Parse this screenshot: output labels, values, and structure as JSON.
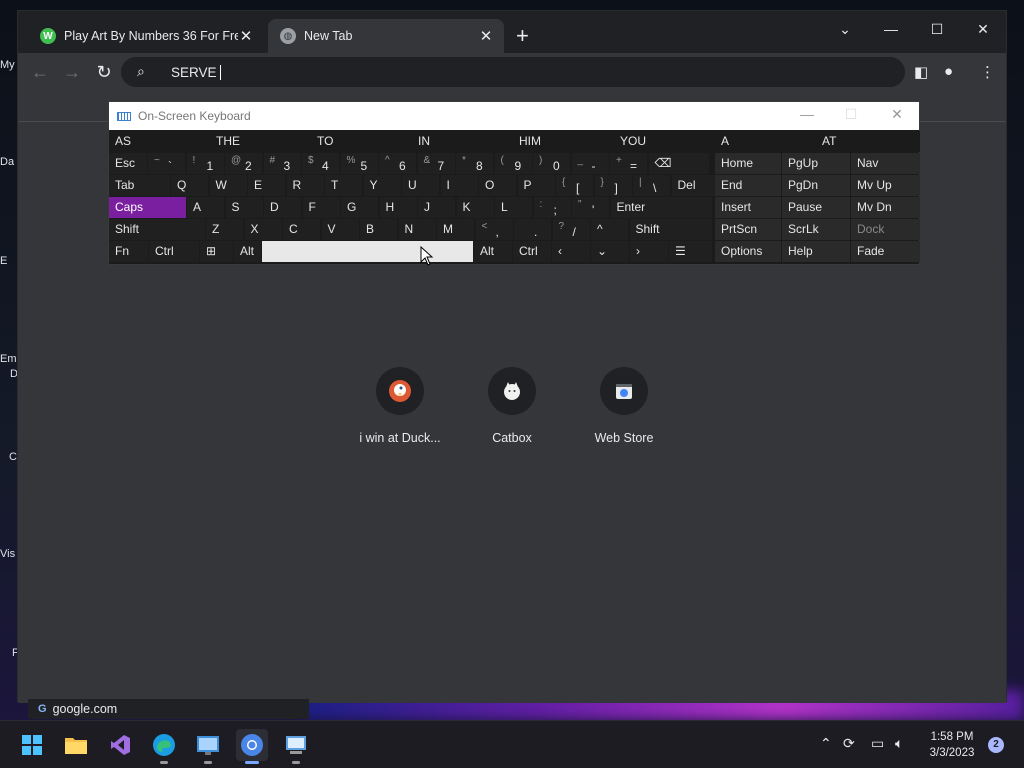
{
  "browser": {
    "tabs": [
      {
        "title": "Play Art By Numbers 36 For Free",
        "favicon": "art-by-numbers-favicon"
      },
      {
        "title": "New Tab",
        "favicon": "globe-icon"
      }
    ],
    "omnibox": {
      "value": "SERVE"
    },
    "shortcuts": [
      {
        "label": "i win at Duck...",
        "icon": "duckduckgo-icon"
      },
      {
        "label": "Catbox",
        "icon": "catbox-icon"
      },
      {
        "label": "Web Store",
        "icon": "web-store-icon"
      }
    ],
    "status_url": "google.com"
  },
  "desktop": {
    "icon_labels": [
      "My",
      "Da",
      "E",
      "Em",
      "D",
      "C",
      "Vis",
      "F"
    ]
  },
  "osk": {
    "title": "On-Screen Keyboard",
    "predictions": [
      "AS",
      "THE",
      "TO",
      "IN",
      "HIM",
      "YOU",
      "A",
      "AT"
    ],
    "row1": [
      {
        "label": "Esc"
      },
      {
        "shift": "~",
        "base": "`"
      },
      {
        "shift": "!",
        "base": "1"
      },
      {
        "shift": "@",
        "base": "2"
      },
      {
        "shift": "#",
        "base": "3"
      },
      {
        "shift": "$",
        "base": "4"
      },
      {
        "shift": "%",
        "base": "5"
      },
      {
        "shift": "^",
        "base": "6"
      },
      {
        "shift": "&",
        "base": "7"
      },
      {
        "shift": "*",
        "base": "8"
      },
      {
        "shift": "(",
        "base": "9"
      },
      {
        "shift": ")",
        "base": "0"
      },
      {
        "shift": "_",
        "base": "-"
      },
      {
        "shift": "+",
        "base": "="
      },
      {
        "label": "⌫"
      }
    ],
    "row2": [
      "Tab",
      "Q",
      "W",
      "E",
      "R",
      "T",
      "Y",
      "U",
      "I",
      "O",
      "P",
      "[",
      "]",
      "\\",
      "Del"
    ],
    "row2_shift": {
      "[": "{",
      "]": "}",
      "\\": "|"
    },
    "row3": [
      "Caps",
      "A",
      "S",
      "D",
      "F",
      "G",
      "H",
      "J",
      "K",
      "L",
      ";",
      "'",
      "Enter"
    ],
    "row3_shift": {
      ";": ":",
      "'": "\""
    },
    "row4": [
      "Shift",
      "Z",
      "X",
      "C",
      "V",
      "B",
      "N",
      "M",
      ",",
      ".",
      "/",
      "^",
      "Shift"
    ],
    "row4_shift": {
      ",": "<",
      ".": ">",
      "/": "?"
    },
    "row5": [
      "Fn",
      "Ctrl",
      "⊞",
      "Alt",
      "",
      "Alt",
      "Ctrl",
      "‹",
      "⌄",
      "›",
      "☰"
    ],
    "nav_keys": [
      [
        "Home",
        "PgUp",
        "Nav"
      ],
      [
        "End",
        "PgDn",
        "Mv Up"
      ],
      [
        "Insert",
        "Pause",
        "Mv Dn"
      ],
      [
        "PrtScn",
        "ScrLk",
        "Dock"
      ],
      [
        "Options",
        "Help",
        "Fade"
      ]
    ]
  },
  "taskbar": {
    "time": "1:58 PM",
    "date": "3/3/2023",
    "notification_count": "2",
    "apps": [
      "windows-start",
      "file-explorer",
      "visual-studio",
      "edge",
      "control-panel",
      "chrome",
      "remote-desktop"
    ]
  },
  "colors": {
    "caps_active": "#7a1fa0",
    "chrome_dark": "#202124",
    "chrome_surface": "#35363a"
  }
}
